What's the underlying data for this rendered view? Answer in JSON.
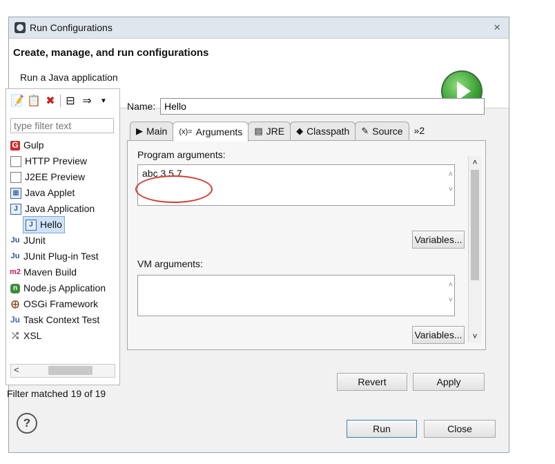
{
  "window": {
    "title": "Run Configurations",
    "close_glyph": "×"
  },
  "header": {
    "title": "Create, manage, and run configurations",
    "description": "Run a Java application",
    "badge_icon": "run-play-icon"
  },
  "sidebar": {
    "toolbar_icons": [
      "new-config-icon",
      "duplicate-icon",
      "delete-icon",
      "collapse-all-icon",
      "filter-icon",
      "dropdown-arrow-icon"
    ],
    "filter_placeholder": "type filter text",
    "items": [
      {
        "label": "Gulp",
        "icon": "gulp-icon"
      },
      {
        "label": "HTTP Preview",
        "icon": "http-preview-icon"
      },
      {
        "label": "J2EE Preview",
        "icon": "j2ee-preview-icon"
      },
      {
        "label": "Java Applet",
        "icon": "java-applet-icon"
      },
      {
        "label": "Java Application",
        "icon": "java-application-icon"
      },
      {
        "label": "Hello",
        "icon": "java-application-icon",
        "child": true,
        "selected": true
      },
      {
        "label": "JUnit",
        "icon": "junit-icon"
      },
      {
        "label": "JUnit Plug-in Test",
        "icon": "junit-plugin-icon"
      },
      {
        "label": "Maven Build",
        "icon": "maven-icon"
      },
      {
        "label": "Node.js Application",
        "icon": "nodejs-icon"
      },
      {
        "label": "OSGi Framework",
        "icon": "osgi-icon"
      },
      {
        "label": "Task Context Test",
        "icon": "task-context-icon"
      },
      {
        "label": "XSL",
        "icon": "xsl-icon"
      }
    ],
    "scroll_left_glyph": "<",
    "filter_status": "Filter matched 19 of 19"
  },
  "config": {
    "name_label": "Name:",
    "name_value": "Hello",
    "tabs": [
      {
        "label": "Main",
        "icon": "main-tab-icon"
      },
      {
        "label": "Arguments",
        "icon": "arguments-tab-icon",
        "active": true
      },
      {
        "label": "JRE",
        "icon": "jre-tab-icon"
      },
      {
        "label": "Classpath",
        "icon": "classpath-tab-icon"
      },
      {
        "label": "Source",
        "icon": "source-tab-icon"
      },
      {
        "label": "»2",
        "icon": ""
      }
    ],
    "program_args_label": "Program arguments:",
    "program_args_value": "abc 3 5.7",
    "vm_args_label": "VM arguments:",
    "vm_args_value": "",
    "variables_label": "Variables..."
  },
  "footer": {
    "revert": "Revert",
    "apply": "Apply",
    "run": "Run",
    "close": "Close",
    "help_glyph": "?"
  },
  "colors": {
    "annotation_circle": "#d03a2e",
    "run_badge": "#2f9a2e",
    "selection": "#cfe2f8"
  }
}
